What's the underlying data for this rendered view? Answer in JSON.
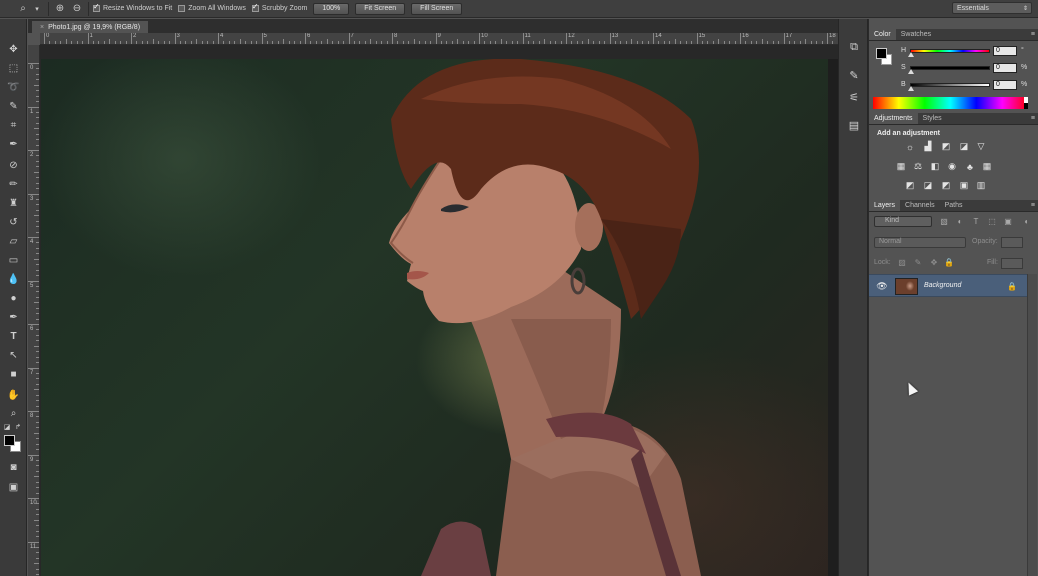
{
  "options_bar": {
    "tool_icon": "zoom-icon",
    "zoom_in_icon": "zoom-in-icon",
    "zoom_out_icon": "zoom-out-icon",
    "checks": [
      {
        "label": "Resize Windows to Fit",
        "checked": true
      },
      {
        "label": "Zoom All Windows",
        "checked": false
      },
      {
        "label": "Scrubby Zoom",
        "checked": true
      }
    ],
    "buttons": [
      "100%",
      "Fit Screen",
      "Fill Screen"
    ],
    "workspace": "Essentials"
  },
  "document": {
    "tab_title": "Photo1.jpg @ 19,9% (RGB/8)",
    "close_glyph": "×",
    "ruler_top_numbers": [
      "0",
      "1",
      "2",
      "3",
      "4",
      "5",
      "6",
      "7",
      "8",
      "9",
      "10",
      "11",
      "12",
      "13",
      "14",
      "15",
      "16",
      "17",
      "18"
    ],
    "ruler_left_numbers": [
      "0",
      "1",
      "2",
      "3",
      "4",
      "5",
      "6",
      "7",
      "8",
      "9",
      "10",
      "11"
    ]
  },
  "panels": {
    "color": {
      "tabs": [
        "Color",
        "Swatches"
      ],
      "sliders": [
        {
          "label": "H",
          "value": "0",
          "unit": "°"
        },
        {
          "label": "S",
          "value": "0",
          "unit": "%"
        },
        {
          "label": "B",
          "value": "0",
          "unit": "%"
        }
      ]
    },
    "adjustments": {
      "tabs": [
        "Adjustments",
        "Styles"
      ],
      "title": "Add an adjustment"
    },
    "layers": {
      "tabs": [
        "Layers",
        "Channels",
        "Paths"
      ],
      "kind": "Kind",
      "blend_mode": "Normal",
      "opacity_label": "Opacity:",
      "lock_label": "Lock:",
      "fill_label": "Fill:",
      "layer_name": "Background"
    }
  },
  "colors": {
    "selected_layer": "#4a5f7a",
    "panel_bg": "#535353",
    "toolbar_bg": "#3a3a3a"
  }
}
